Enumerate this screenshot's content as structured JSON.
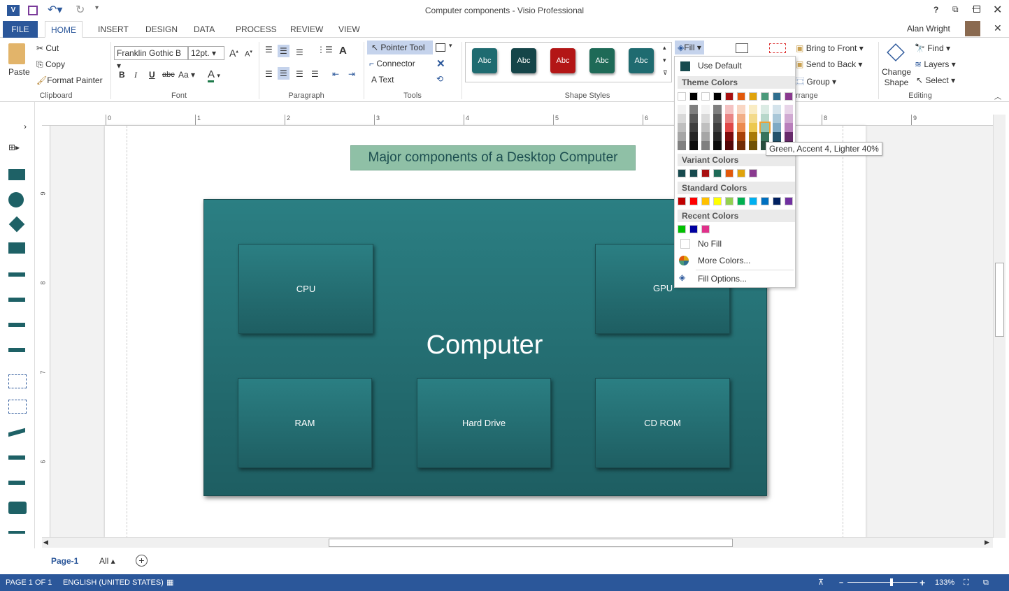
{
  "window": {
    "title": "Computer components - Visio Professional",
    "user": "Alan Wright",
    "help": "?"
  },
  "tabs": [
    "FILE",
    "HOME",
    "INSERT",
    "DESIGN",
    "DATA",
    "PROCESS",
    "REVIEW",
    "VIEW"
  ],
  "clipboard": {
    "paste": "Paste",
    "cut": "Cut",
    "copy": "Copy",
    "format_painter": "Format Painter",
    "label": "Clipboard"
  },
  "font": {
    "name": "Franklin Gothic B",
    "size": "12pt.",
    "bold": "B",
    "italic": "I",
    "underline": "U",
    "strike": "abc",
    "case": "Aa",
    "label": "Font"
  },
  "paragraph": {
    "label": "Paragraph"
  },
  "tools": {
    "pointer": "Pointer Tool",
    "connector": "Connector",
    "text": "Text",
    "label": "Tools"
  },
  "shape_styles": {
    "label": "Shape Styles",
    "items": [
      {
        "text": "Abc",
        "color": "#1f6b70"
      },
      {
        "text": "Abc",
        "color": "#154549"
      },
      {
        "text": "Abc",
        "color": "#b31616"
      },
      {
        "text": "Abc",
        "color": "#1e6a57"
      },
      {
        "text": "Abc",
        "color": "#1f6b70"
      }
    ]
  },
  "arrange": {
    "bring_front": "Bring to Front",
    "send_back": "Send to Back",
    "group": "Group",
    "label": "rrange"
  },
  "editing": {
    "change_shape": "Change Shape",
    "find": "Find",
    "layers": "Layers",
    "select": "Select",
    "label": "Editing"
  },
  "fill_menu": {
    "button": "Fill",
    "use_default": "Use Default",
    "default_color": "#174a4e",
    "theme_header": "Theme Colors",
    "theme_top": [
      "#ffffff",
      "#000000",
      "#ffffff",
      "#000000",
      "#a80f10",
      "#e2580a",
      "#e0a30b",
      "#4a9a7a",
      "#2e6e8e",
      "#8a3a8f"
    ],
    "theme_shades": [
      [
        "#f2f2f2",
        "#d9d9d9",
        "#bfbfbf",
        "#a6a6a6",
        "#808080"
      ],
      [
        "#7f7f7f",
        "#595959",
        "#3f3f3f",
        "#262626",
        "#0d0d0d"
      ],
      [
        "#f2f2f2",
        "#d9d9d9",
        "#bfbfbf",
        "#a6a6a6",
        "#808080"
      ],
      [
        "#7f7f7f",
        "#595959",
        "#3f3f3f",
        "#262626",
        "#0d0d0d"
      ],
      [
        "#f4c2c2",
        "#ea8585",
        "#e04848",
        "#7e0b0c",
        "#540708"
      ],
      [
        "#f9d6c3",
        "#f2ae86",
        "#ec8a4d",
        "#a94207",
        "#712c05"
      ],
      [
        "#f9ecc4",
        "#f3da8a",
        "#ecc84f",
        "#a87a08",
        "#705106"
      ],
      [
        "#dbebe4",
        "#b7d7ca",
        "#92c2b0",
        "#37735b",
        "#254d3d"
      ],
      [
        "#d4e3eb",
        "#a9c7d8",
        "#7faac4",
        "#22526b",
        "#173747"
      ],
      [
        "#e7d4e8",
        "#d0aad2",
        "#b87fbb",
        "#672b6b",
        "#451d48"
      ]
    ],
    "hover_tooltip": "Green, Accent 4, Lighter 40%",
    "variant_header": "Variant Colors",
    "variant": [
      "#174a4e",
      "#174a4e",
      "#a80f10",
      "#1e6a57",
      "#e2580a",
      "#e0a30b",
      "#8a3a8f"
    ],
    "standard_header": "Standard Colors",
    "standard": [
      "#c00000",
      "#ff0000",
      "#ffc000",
      "#ffff00",
      "#92d050",
      "#00b050",
      "#00b0f0",
      "#0070c0",
      "#002060",
      "#7030a0"
    ],
    "recent_header": "Recent Colors",
    "recent": [
      "#00c000",
      "#0000a0",
      "#e0308a"
    ],
    "no_fill": "No Fill",
    "more_colors": "More Colors...",
    "fill_options": "Fill Options..."
  },
  "ruler_h": [
    "0",
    "1",
    "2",
    "3",
    "4",
    "5",
    "6",
    "7",
    "8",
    "9"
  ],
  "ruler_v": [
    "9",
    "8",
    "7",
    "6"
  ],
  "diagram": {
    "title": "Major components of a Desktop Computer",
    "container": "Computer",
    "boxes": [
      "CPU",
      "GPU",
      "RAM",
      "Hard Drive",
      "CD ROM"
    ]
  },
  "page_tabs": {
    "page": "Page-1",
    "all": "All"
  },
  "status": {
    "page": "PAGE 1 OF 1",
    "language": "ENGLISH (UNITED STATES)",
    "zoom": "133%",
    "zoom_level_percent": 133
  }
}
